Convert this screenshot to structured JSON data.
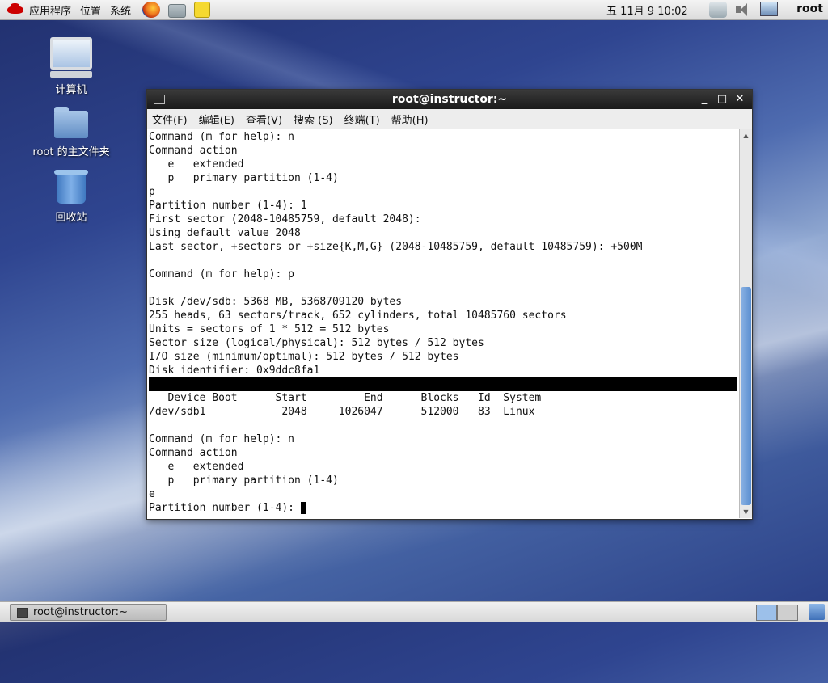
{
  "top_panel": {
    "menus": [
      "应用程序",
      "位置",
      "系统"
    ],
    "clock": "五 11月  9 10:02",
    "user": "root"
  },
  "desktop": {
    "icons": [
      {
        "label": "计算机"
      },
      {
        "label": "root 的主文件夹"
      },
      {
        "label": "回收站"
      }
    ]
  },
  "window": {
    "title": "root@instructor:~",
    "menu": [
      "文件(F)",
      "编辑(E)",
      "查看(V)",
      "搜索 (S)",
      "终端(T)",
      "帮助(H)"
    ],
    "lines": [
      "Command (m for help): n",
      "Command action",
      "   e   extended",
      "   p   primary partition (1-4)",
      "p",
      "Partition number (1-4): 1",
      "First sector (2048-10485759, default 2048):",
      "Using default value 2048",
      "Last sector, +sectors or +size{K,M,G} (2048-10485759, default 10485759): +500M",
      "",
      "Command (m for help): p",
      "",
      "Disk /dev/sdb: 5368 MB, 5368709120 bytes",
      "255 heads, 63 sectors/track, 652 cylinders, total 10485760 sectors",
      "Units = sectors of 1 * 512 = 512 bytes",
      "Sector size (logical/physical): 512 bytes / 512 bytes",
      "I/O size (minimum/optimal): 512 bytes / 512 bytes",
      "Disk identifier: 0x9ddc8fa1",
      "",
      "   Device Boot      Start         End      Blocks   Id  System",
      "/dev/sdb1            2048     1026047      512000   83  Linux",
      "",
      "Command (m for help): n",
      "Command action",
      "   e   extended",
      "   p   primary partition (1-4)",
      "e"
    ],
    "prompt": "Partition number (1-4): "
  },
  "taskbar": {
    "task_label": "root@instructor:~"
  }
}
